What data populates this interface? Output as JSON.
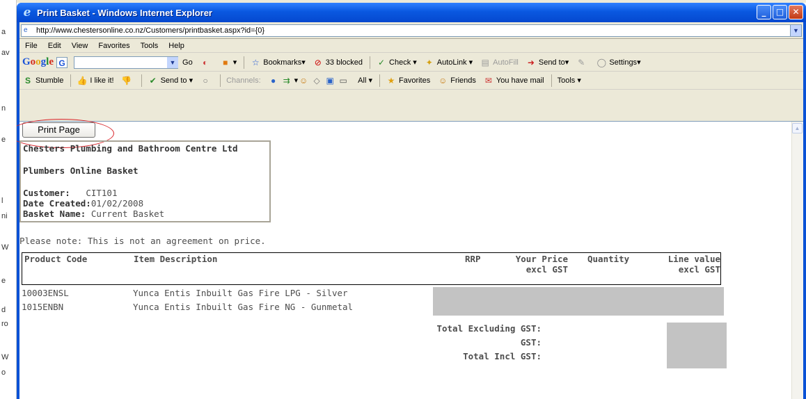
{
  "window": {
    "title": "Print Basket - Windows Internet Explorer"
  },
  "address": {
    "url": "http://www.chestersonline.co.nz/Customers/printbasket.aspx?id={0}"
  },
  "menu": [
    "File",
    "Edit",
    "View",
    "Favorites",
    "Tools",
    "Help"
  ],
  "google_bar": {
    "go_label": "Go",
    "bookmarks_label": "Bookmarks",
    "blocked_label": "33 blocked",
    "check_label": "Check",
    "autolink_label": "AutoLink",
    "autofill_label": "AutoFill",
    "sendto_label": "Send to",
    "settings_label": "Settings"
  },
  "stumble_bar": {
    "stumble_label": "Stumble",
    "ilike_label": "I like it!",
    "sendto_label": "Send to",
    "channels_label": "Channels:",
    "all_label": "All",
    "favorites_label": "Favorites",
    "friends_label": "Friends",
    "mail_label": "You have mail",
    "tools_label": "Tools"
  },
  "page": {
    "print_button": "Print Page",
    "company": "Chesters Plumbing and Bathroom Centre Ltd",
    "heading": "Plumbers Online Basket",
    "customer_label": "Customer:",
    "customer_value": "CIT101",
    "date_label": "Date Created:",
    "date_value": "01/02/2008",
    "basket_label": "Basket Name:",
    "basket_value": "Current Basket",
    "note": "Please note: This is not an agreement on price.",
    "columns": {
      "product_code": "Product Code",
      "item_description": "Item Description",
      "rrp": "RRP",
      "your_price_1": "Your Price",
      "your_price_2": "excl GST",
      "quantity": "Quantity",
      "line_value_1": "Line value",
      "line_value_2": "excl GST"
    },
    "rows": [
      {
        "code": "10003ENSL",
        "description": "Yunca Entis Inbuilt Gas Fire LPG - Silver"
      },
      {
        "code": "1015ENBN",
        "description": "Yunca Entis Inbuilt Gas Fire NG - Gunmetal"
      }
    ],
    "totals": {
      "excl_label": "Total Excluding GST:",
      "gst_label": "GST:",
      "incl_label": "Total Incl GST:"
    }
  },
  "behind_window_fragments": [
    "a",
    "av",
    "n",
    "",
    "e",
    "l",
    "ni",
    "W",
    "e",
    "d",
    "ro",
    "W",
    "o"
  ]
}
